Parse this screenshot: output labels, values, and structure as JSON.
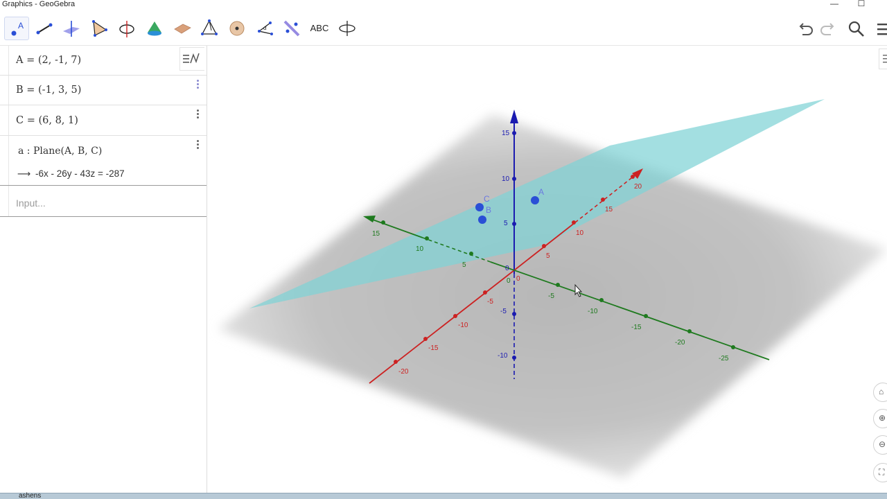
{
  "window": {
    "title": "Graphics - GeoGebra",
    "minimize": "—",
    "maximize": "☐"
  },
  "toolbar": {
    "tools": [
      {
        "name": "move-point-tool-icon"
      },
      {
        "name": "segment-tool-icon"
      },
      {
        "name": "perpendicular-line-tool-icon"
      },
      {
        "name": "polygon-tool-icon"
      },
      {
        "name": "circle-axis-tool-icon"
      },
      {
        "name": "cone-tool-icon"
      },
      {
        "name": "plane-tool-icon"
      },
      {
        "name": "pyramid-tool-icon"
      },
      {
        "name": "sphere-tool-icon"
      },
      {
        "name": "angle-tool-icon"
      },
      {
        "name": "reflect-tool-icon"
      },
      {
        "name": "text-tool-icon",
        "label": "ABC"
      },
      {
        "name": "rotate-view-tool-icon"
      }
    ],
    "undo": "undo-icon",
    "redo": "redo-icon",
    "search": "search-icon",
    "menu": "menu-icon"
  },
  "algebra": {
    "items": [
      {
        "text": "A = (2, -1, 7)"
      },
      {
        "text": "B = (-1, 3, 5)"
      },
      {
        "text": "C = (6, 8, 1)"
      },
      {
        "text": "a : Plane(A, B, C)",
        "output": "-6x - 26y - 43z = -287"
      }
    ],
    "input_placeholder": "Input..."
  },
  "graphics": {
    "points": [
      {
        "label": "A",
        "coords": [
          2,
          -1,
          7
        ]
      },
      {
        "label": "B",
        "coords": [
          -1,
          3,
          5
        ]
      },
      {
        "label": "C",
        "coords": [
          6,
          8,
          1
        ]
      }
    ],
    "axis_labels": {
      "z": [
        "15",
        "10",
        "5",
        "0",
        "-5",
        "-10"
      ],
      "x": [
        "20",
        "15",
        "10",
        "5",
        "0",
        "-5",
        "-10",
        "-15",
        "-20"
      ],
      "y": [
        "15",
        "10",
        "5",
        "0",
        "-5",
        "-10",
        "-15",
        "-20",
        "-25"
      ]
    },
    "colors": {
      "x_axis": "#cc2222",
      "y_axis": "#1f7a1f",
      "z_axis": "#1a1ab0",
      "plane": "#7fd3d6",
      "point": "#2a4fd6"
    }
  },
  "side_controls": [
    "home-icon",
    "zoom-in-icon",
    "zoom-out-icon",
    "fullscreen-icon"
  ],
  "taskbar": {
    "label": "ashens"
  }
}
